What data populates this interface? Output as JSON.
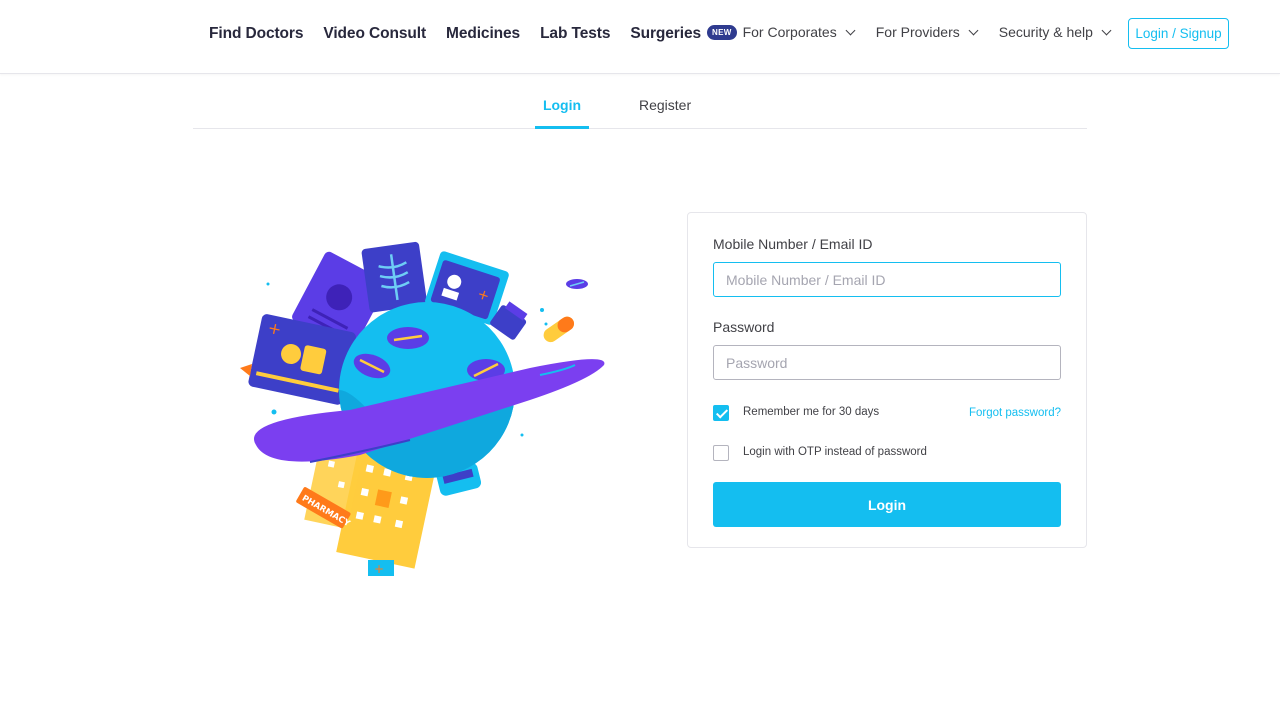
{
  "header": {
    "nav_main": [
      "Find Doctors",
      "Video Consult",
      "Medicines",
      "Lab Tests",
      "Surgeries"
    ],
    "new_badge": "NEW",
    "for_corporates": "For Corporates",
    "for_providers": "For Providers",
    "security_help": "Security & help",
    "login_signup": "Login / Signup"
  },
  "tabs": {
    "login": "Login",
    "register": "Register"
  },
  "illustration": {
    "pharmacy_label": "PHARMACY"
  },
  "form": {
    "mobile_label": "Mobile Number / Email ID",
    "mobile_placeholder": "Mobile Number / Email ID",
    "password_label": "Password",
    "password_placeholder": "Password",
    "remember_label": "Remember me for 30 days",
    "remember_checked": true,
    "forgot_label": "Forgot password?",
    "otp_label": "Login with OTP instead of password",
    "otp_checked": false,
    "login_button": "Login"
  },
  "colors": {
    "accent": "#14bef0",
    "nav_dark": "#28283c",
    "badge": "#2f3b8f"
  }
}
